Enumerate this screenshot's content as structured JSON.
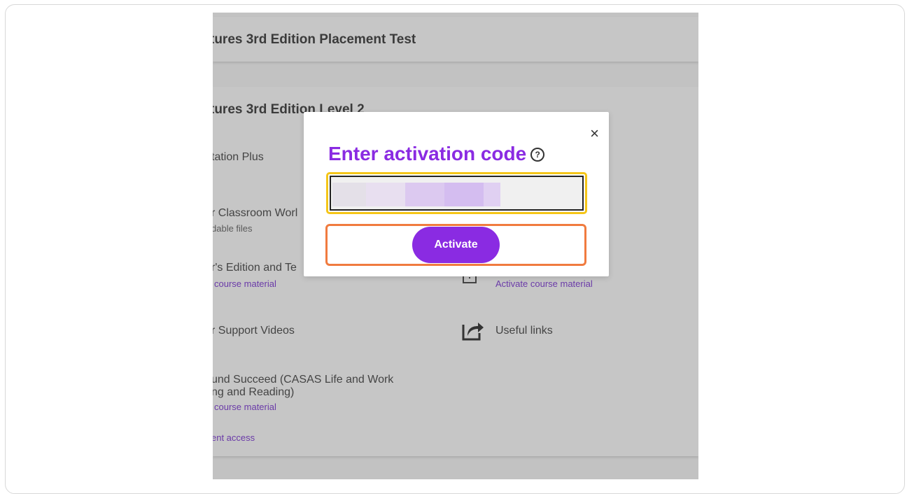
{
  "background": {
    "card1_title": "tures 3rd Edition Placement Test",
    "card2_title": "tures 3rd Edition Level 2",
    "left_items": [
      {
        "title": "tation Plus"
      },
      {
        "title": "r Classroom Worl",
        "sub": "dable files"
      },
      {
        "title": "r's Edition and Te",
        "link": "course material"
      },
      {
        "title": "r Support Videos"
      },
      {
        "title_line1": "und Succeed (CASAS Life and Work",
        "title_line2": "ng and Reading)",
        "link": "course material"
      }
    ],
    "bottom_link": "ent access",
    "right_items": [
      {
        "link": "Activate course material",
        "icon": "activate-icon"
      },
      {
        "title": "Useful links",
        "icon": "share-icon"
      }
    ]
  },
  "modal": {
    "title": "Enter activation code",
    "help_icon": "?",
    "close_icon": "×",
    "input_value": "",
    "activate_label": "Activate"
  },
  "colors": {
    "accent": "#8a2be2",
    "highlight_yellow": "#f5c518",
    "highlight_orange": "#f07b3f",
    "overlay": "#c2c2c2"
  }
}
